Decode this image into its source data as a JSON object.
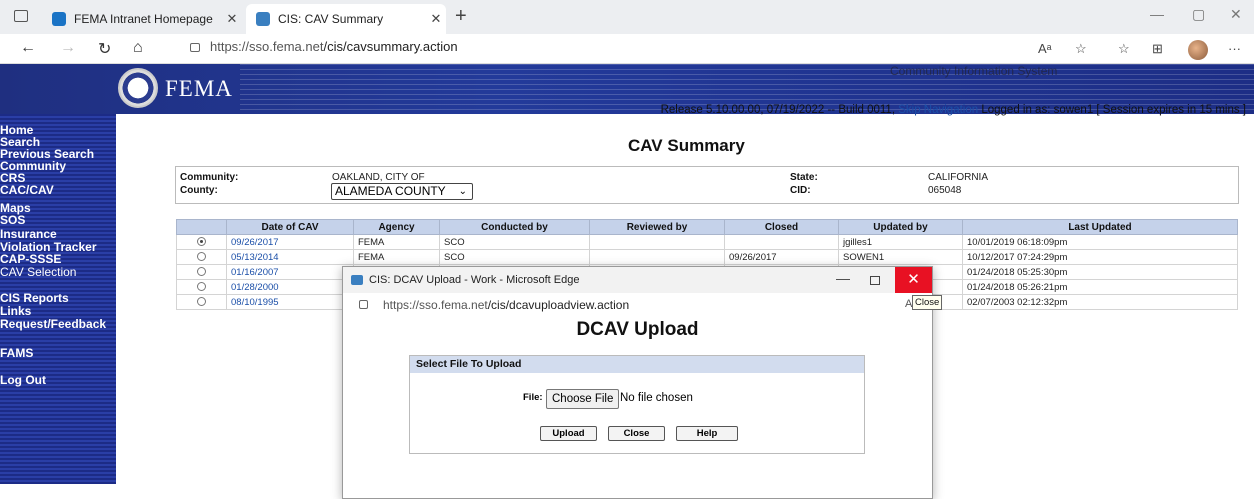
{
  "browser": {
    "tabs": [
      {
        "title": "FEMA Intranet Homepage",
        "close": "✕"
      },
      {
        "title": "CIS: CAV Summary",
        "close": "✕"
      }
    ],
    "new_tab": "+",
    "url_host": "https://sso.fema.net",
    "url_path": "/cis/cavsummary.action",
    "window_controls": [
      "—",
      "▢",
      "✕"
    ],
    "toolbar_icons": [
      "read-aloud-icon",
      "favorites-add-icon",
      "favorites-icon",
      "collections-icon",
      "profile-icon",
      "more-icon"
    ],
    "toolbar_glyphs": [
      "Aᵃ",
      "☆",
      "☆",
      "⊞",
      "",
      "···"
    ]
  },
  "header": {
    "logo_text": "FEMA",
    "system_name": "Community Information System",
    "release": "Release 5.10.00.00, 07/19/2022 -- Build 0011, ",
    "skip_nav": "Skip Navigation",
    "logged_in": " Logged in as: sowen1   [ Session expires in 15 mins ]"
  },
  "leftnav": [
    {
      "label": "Home",
      "bold": true
    },
    {
      "label": "Search",
      "bold": true
    },
    {
      "label": "Previous Search",
      "bold": true
    },
    {
      "label": "Community",
      "bold": true
    },
    {
      "label": "CRS",
      "bold": true
    },
    {
      "label": "CAC/CAV",
      "bold": true
    },
    {
      "label": "Maps",
      "bold": true
    },
    {
      "label": "SOS",
      "bold": true
    },
    {
      "label": "Insurance",
      "bold": true
    },
    {
      "label": "Violation Tracker",
      "bold": true
    },
    {
      "label": "CAP-SSSE",
      "bold": true
    },
    {
      "label": "CAV Selection",
      "bold": false
    },
    {
      "label": "CIS Reports",
      "bold": true
    },
    {
      "label": "Links",
      "bold": true
    },
    {
      "label": "Request/Feedback",
      "bold": true
    },
    {
      "label": "FAMS",
      "bold": true
    },
    {
      "label": "Log Out",
      "bold": true
    }
  ],
  "page": {
    "title": "CAV Summary",
    "community_label": "Community:",
    "community_value": "OAKLAND, CITY OF",
    "county_label": "County:",
    "county_selected": "ALAMEDA COUNTY",
    "state_label": "State:",
    "state_value": "CALIFORNIA",
    "cid_label": "CID:",
    "cid_value": "065048"
  },
  "table": {
    "columns": [
      "",
      "Date of CAV",
      "Agency",
      "Conducted by",
      "Reviewed by",
      "Closed",
      "Updated by",
      "Last Updated"
    ],
    "rows": [
      {
        "selected": true,
        "date": "09/26/2017",
        "agency": "FEMA",
        "conducted": "SCO",
        "reviewed": "",
        "closed": "",
        "updated_by": "jgilles1",
        "last_updated": "10/01/2019 06:18:09pm"
      },
      {
        "selected": false,
        "date": "05/13/2014",
        "agency": "FEMA",
        "conducted": "SCO",
        "reviewed": "",
        "closed": "09/26/2017",
        "updated_by": "SOWEN1",
        "last_updated": "10/12/2017 07:24:29pm"
      },
      {
        "selected": false,
        "date": "01/16/2007",
        "agency": "",
        "conducted": "",
        "reviewed": "",
        "closed": "",
        "updated_by": "",
        "last_updated": "01/24/2018 05:25:30pm"
      },
      {
        "selected": false,
        "date": "01/28/2000",
        "agency": "",
        "conducted": "",
        "reviewed": "",
        "closed": "",
        "updated_by": "",
        "last_updated": "01/24/2018 05:26:21pm"
      },
      {
        "selected": false,
        "date": "08/10/1995",
        "agency": "",
        "conducted": "",
        "reviewed": "",
        "closed": "",
        "updated_by": "",
        "last_updated": "02/07/2003 02:12:32pm"
      }
    ]
  },
  "popup": {
    "window_title": "CIS: DCAV Upload - Work - Microsoft Edge",
    "min": "—",
    "close": "✕",
    "url_host": "https://sso.fema.net",
    "url_path": "/cis/dcavuploadview.action",
    "reader": "A",
    "tooltip": "Close",
    "heading": "DCAV Upload",
    "section_title": "Select File To Upload",
    "file_label": "File:",
    "choose_button": "Choose File",
    "file_status": "No file chosen",
    "buttons": [
      "Upload",
      "Close",
      "Help"
    ]
  }
}
